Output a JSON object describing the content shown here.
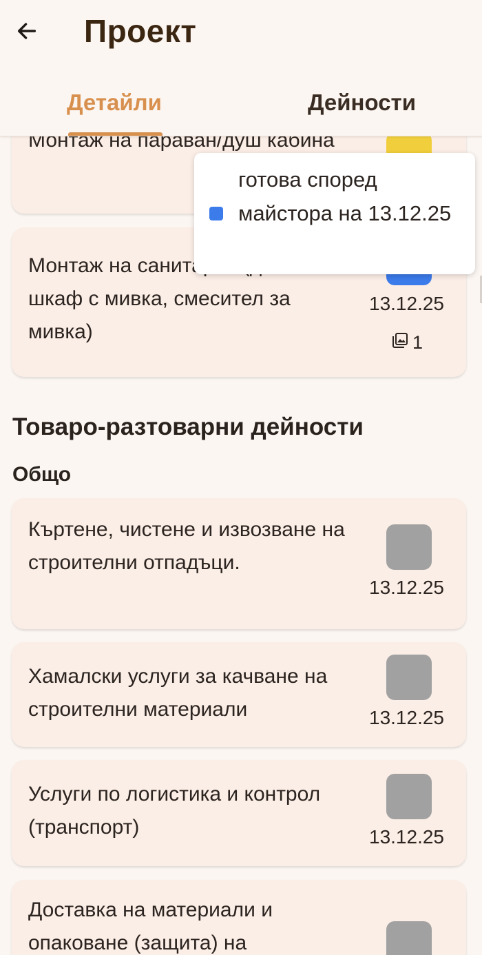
{
  "header": {
    "title": "Проект",
    "back_icon": "arrow-left-icon"
  },
  "tabs": [
    {
      "label": "Детайли",
      "active": true
    },
    {
      "label": "Дейности",
      "active": false
    }
  ],
  "colors": {
    "accent": "#d8904f",
    "status_yellow": "#f1cf3c",
    "status_blue": "#3b7bea",
    "status_gray": "#a1a1a1"
  },
  "cards_top": [
    {
      "text": "Монтаж на параван/душ кабина",
      "status_color": "#f1cf3c"
    },
    {
      "text": "Монтаж на санитария (долен шкаф с мивка, смесител за мивка)",
      "status_color": "#3b7bea",
      "date": "13.12.25",
      "photo_count": "1",
      "photo_icon": "photo-library-icon"
    }
  ],
  "tooltip": {
    "text": "готова според майстора на 13.12.25",
    "status_color": "#3b7bea"
  },
  "section": {
    "title": "Товаро-разтоварни дейности",
    "subsection": "Общо",
    "items": [
      {
        "text": "Къртене, чистене и извозване на строителни отпадъци.",
        "date": "13.12.25",
        "status_color": "#a1a1a1"
      },
      {
        "text": "Хамалски услуги за качване на строителни материали",
        "date": "13.12.25",
        "status_color": "#a1a1a1"
      },
      {
        "text": "Услуги по логистика и контрол (транспорт)",
        "date": "13.12.25",
        "status_color": "#a1a1a1"
      },
      {
        "text": "Доставка на материали и опаковане (защита) на",
        "status_color": "#a1a1a1"
      }
    ]
  }
}
